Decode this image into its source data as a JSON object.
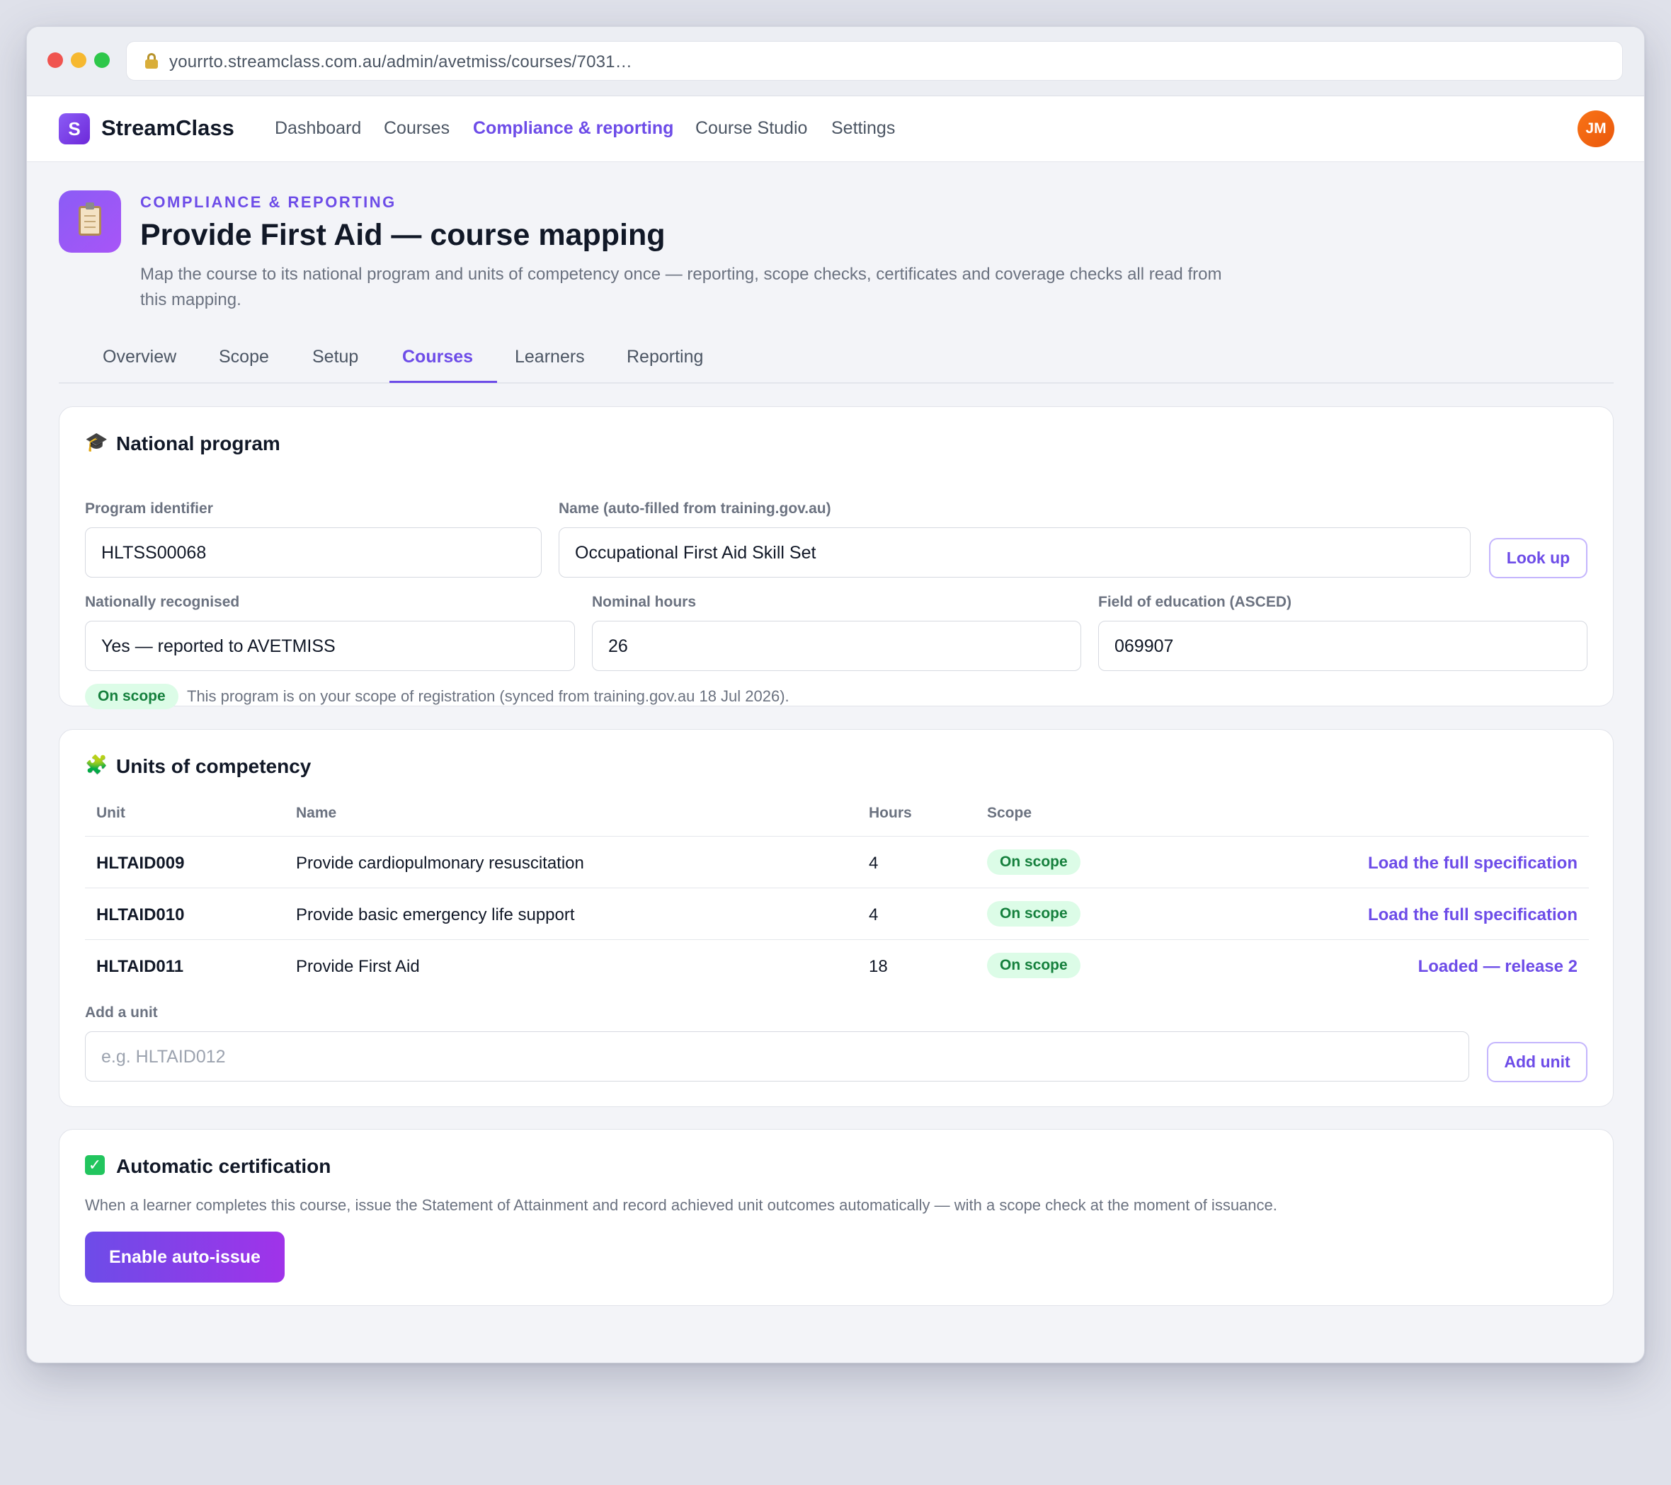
{
  "browser": {
    "url": "yourrto.streamclass.com.au/admin/avetmiss/courses/7031…"
  },
  "app": {
    "logo_letter": "S",
    "brand": "StreamClass",
    "nav": [
      "Dashboard",
      "Courses",
      "Compliance & reporting",
      "Course Studio",
      "Settings"
    ],
    "active_nav": "Compliance & reporting",
    "avatar_initials": "JM",
    "accent_color": "#6d4ce8"
  },
  "header": {
    "icon": "clipboard-icon",
    "eyebrow": "COMPLIANCE & REPORTING",
    "title": "Provide First Aid — course mapping",
    "description": "Map the course to its national program and units of competency once — reporting, scope checks, certificates and coverage checks all read from this mapping."
  },
  "tabs": [
    "Overview",
    "Scope",
    "Setup",
    "Courses",
    "Learners",
    "Reporting"
  ],
  "active_tab": "Courses",
  "national_program": {
    "icon": "graduation-cap-icon",
    "title": "National program",
    "program_identifier_label": "Program identifier",
    "program_identifier_value": "HLTSS00068",
    "name_label": "Name (auto-filled from training.gov.au)",
    "name_value": "Occupational First Aid Skill Set",
    "lookup_label": "Look up",
    "recognised_label": "Nationally recognised",
    "recognised_value": "Yes — reported to AVETMISS",
    "hours_label": "Nominal hours",
    "hours_value": "26",
    "field_label": "Field of education (ASCED)",
    "field_value": "069907",
    "scope_badge": "On scope",
    "scope_note": "This program is on your scope of registration (synced from training.gov.au 18 Jul 2026)."
  },
  "units": {
    "icon": "puzzle-icon",
    "title": "Units of competency",
    "columns": [
      "Unit",
      "Name",
      "Hours",
      "Scope"
    ],
    "rows": [
      {
        "code": "HLTAID009",
        "name": "Provide cardiopulmonary resuscitation",
        "hours": "4",
        "scope": "On scope",
        "action": "Load the full specification"
      },
      {
        "code": "HLTAID010",
        "name": "Provide basic emergency life support",
        "hours": "4",
        "scope": "On scope",
        "action": "Load the full specification"
      },
      {
        "code": "HLTAID011",
        "name": "Provide First Aid",
        "hours": "18",
        "scope": "On scope",
        "action": "Loaded — release 2"
      }
    ],
    "add_label": "Add a unit",
    "add_placeholder": "e.g. HLTAID012",
    "add_button": "Add unit"
  },
  "certification": {
    "icon": "checkmark-icon",
    "title": "Automatic certification",
    "description": "When a learner completes this course, issue the Statement of Attainment and record achieved unit outcomes automatically — with a scope check at the moment of issuance.",
    "button": "Enable auto-issue"
  }
}
